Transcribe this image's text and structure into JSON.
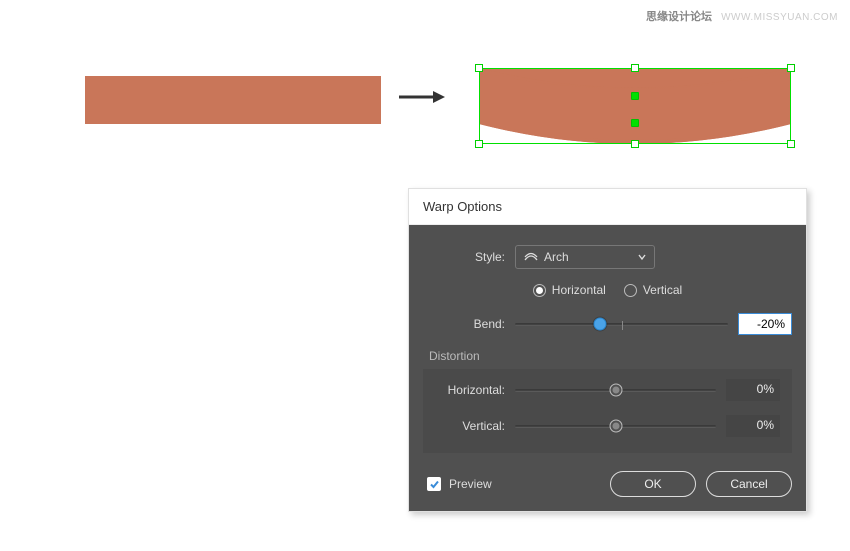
{
  "watermark": {
    "cn": "思缘设计论坛",
    "en": "WWW.MISSYUAN.COM"
  },
  "dialog": {
    "title": "Warp Options",
    "style_label": "Style:",
    "style_value": "Arch",
    "orientation": {
      "horizontal": "Horizontal",
      "vertical": "Vertical",
      "selected": "horizontal"
    },
    "bend": {
      "label": "Bend:",
      "value": "-20%",
      "position_pct": 40
    },
    "distortion": {
      "section_label": "Distortion",
      "horizontal_label": "Horizontal:",
      "horizontal_value": "0%",
      "horizontal_position_pct": 50,
      "vertical_label": "Vertical:",
      "vertical_value": "0%",
      "vertical_position_pct": 50
    },
    "preview_label": "Preview",
    "preview_checked": true,
    "ok_label": "OK",
    "cancel_label": "Cancel"
  },
  "shapes": {
    "color": "#c97659",
    "selection_color": "#00e000"
  }
}
